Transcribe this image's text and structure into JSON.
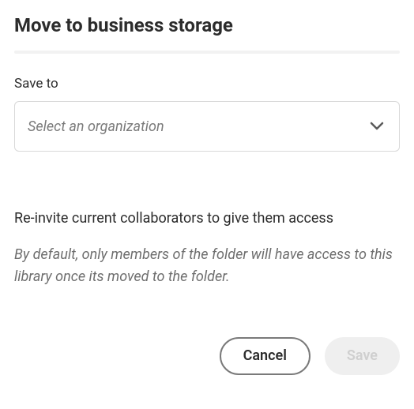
{
  "title": "Move to business storage",
  "saveTo": {
    "label": "Save to",
    "placeholder": "Select an organization"
  },
  "reinvite": {
    "heading": "Re-invite current collaborators to give them access",
    "description": "By default, only members of the folder will have access to this library once its moved to the folder."
  },
  "buttons": {
    "cancel": "Cancel",
    "save": "Save"
  }
}
